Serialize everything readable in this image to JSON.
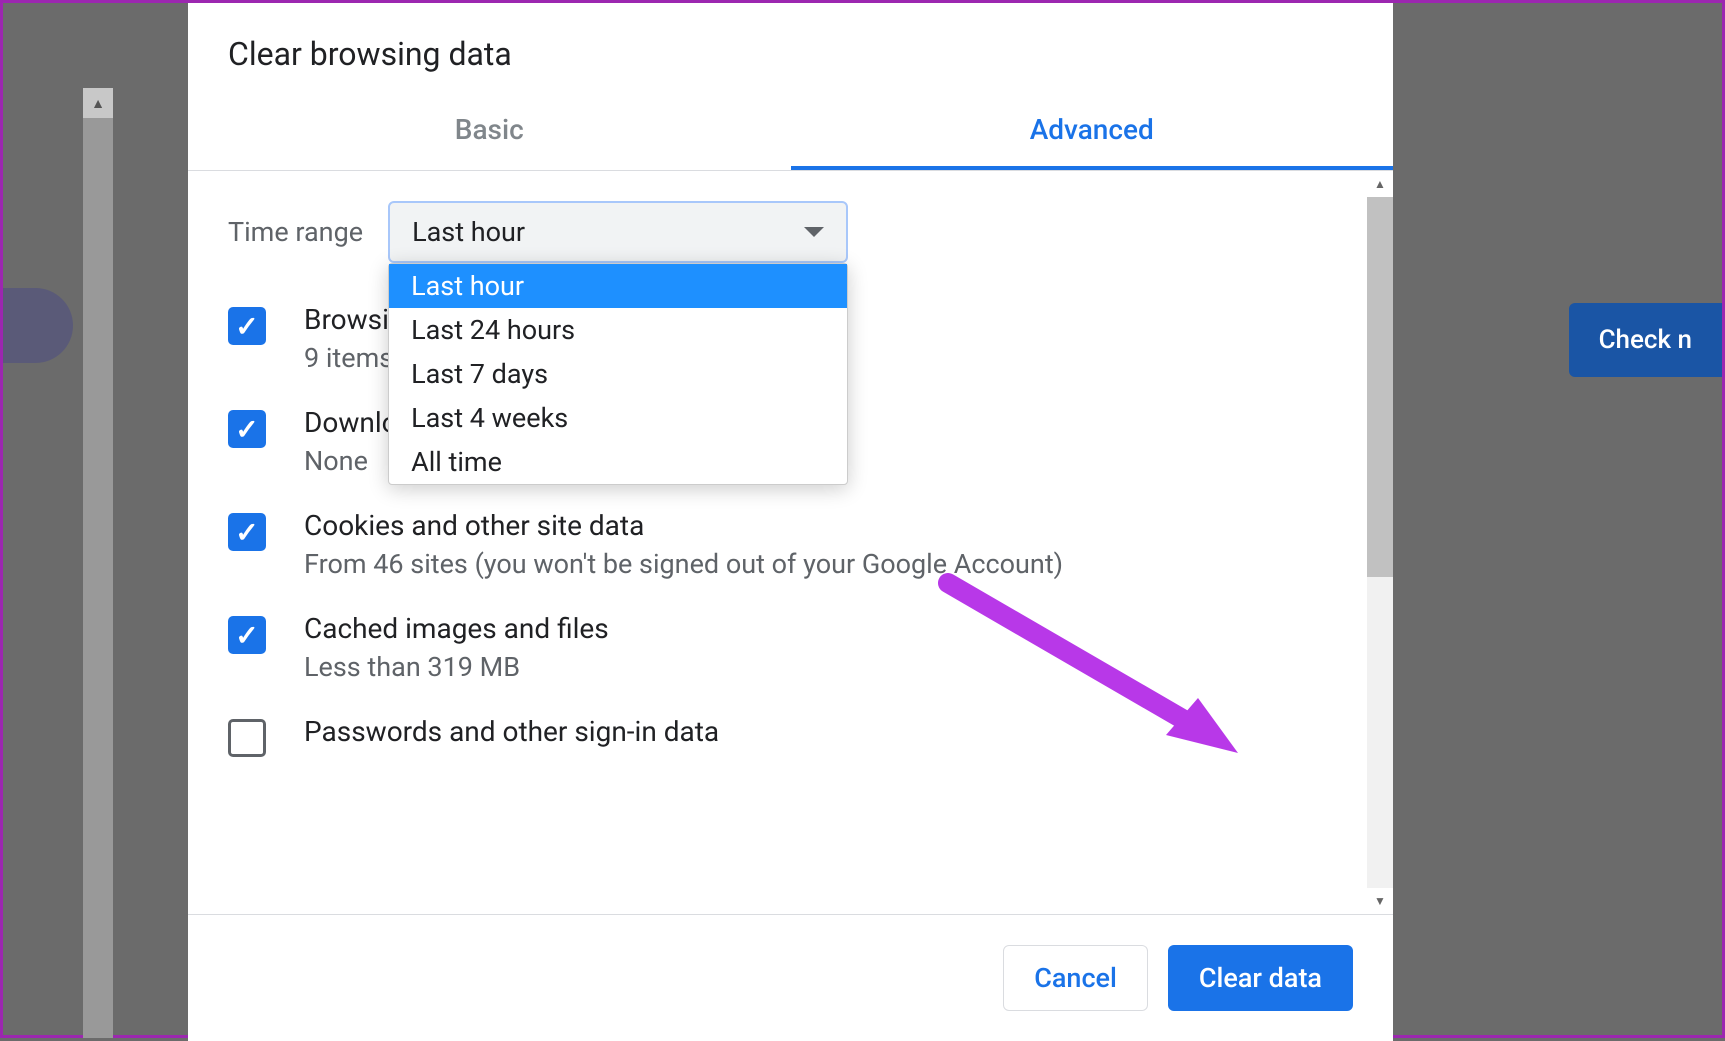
{
  "dialog": {
    "title": "Clear browsing data",
    "tabs": {
      "basic": "Basic",
      "advanced": "Advanced"
    },
    "timeRange": {
      "label": "Time range",
      "selected": "Last hour",
      "options": [
        "Last hour",
        "Last 24 hours",
        "Last 7 days",
        "Last 4 weeks",
        "All time"
      ]
    },
    "items": {
      "browsing": {
        "title": "Browsing history",
        "desc": "9 items",
        "checked": true
      },
      "download": {
        "title": "Download history",
        "desc": "None",
        "checked": true
      },
      "cookies": {
        "title": "Cookies and other site data",
        "desc": "From 46 sites (you won't be signed out of your Google Account)",
        "checked": true
      },
      "cached": {
        "title": "Cached images and files",
        "desc": "Less than 319 MB",
        "checked": true
      },
      "passwords": {
        "title": "Passwords and other sign-in data",
        "checked": false
      }
    },
    "buttons": {
      "cancel": "Cancel",
      "clear": "Clear data"
    }
  },
  "backdrop": {
    "checkButton": "Check n"
  }
}
